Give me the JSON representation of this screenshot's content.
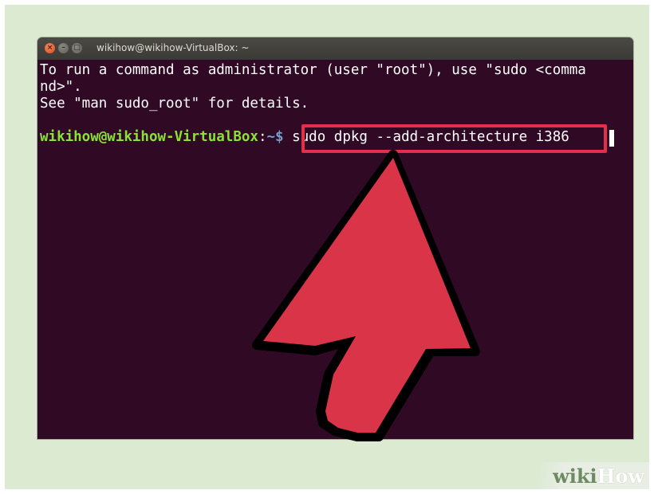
{
  "window": {
    "title": "wikihow@wikihow-VirtualBox: ~",
    "close_glyph": "×",
    "min_glyph": "–",
    "max_glyph": "□"
  },
  "terminal": {
    "lines": [
      "To run a command as administrator (user \"root\"), use \"sudo <comma",
      "nd>\".",
      "See \"man sudo_root\" for details."
    ],
    "prompt_user": "wikihow@wikihow-VirtualBox",
    "prompt_sep": ":",
    "prompt_path": "~$",
    "command": " sudo dpkg --add-architecture i386"
  },
  "watermark": {
    "part1": "wiki",
    "part2": "How"
  },
  "colors": {
    "terminal_bg": "#300a24",
    "prompt_green": "#8ae234",
    "highlight_red": "#e2304a",
    "backdrop": "#dcead2"
  },
  "icons": [
    "window-close-icon",
    "window-minimize-icon",
    "window-maximize-icon",
    "pointer-arrow-icon"
  ]
}
